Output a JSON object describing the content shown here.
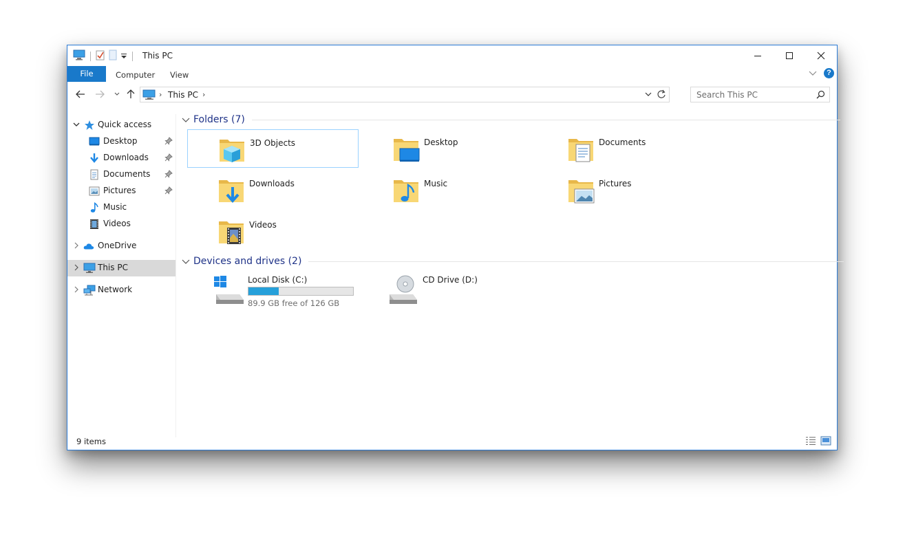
{
  "window": {
    "title": "This PC",
    "accent_color": "#1979ca"
  },
  "quick_access_toolbar": {
    "icons": [
      "computer-icon",
      "properties-icon",
      "new-folder-icon",
      "customize-dropdown-icon"
    ]
  },
  "window_controls": {
    "icons": [
      "minimize-icon",
      "maximize-icon",
      "close-icon"
    ]
  },
  "ribbon": {
    "tabs": [
      {
        "label": "File",
        "active": true
      },
      {
        "label": "Computer"
      },
      {
        "label": "View"
      }
    ],
    "help_label": "?"
  },
  "navigation": {
    "icons": [
      "back-arrow-icon",
      "forward-arrow-icon",
      "recent-locations-icon",
      "up-arrow-icon"
    ],
    "address": {
      "path": "This PC"
    },
    "search": {
      "placeholder": "Search This PC"
    }
  },
  "sidebar": {
    "items": [
      {
        "label": "Quick access",
        "icon": "star-icon",
        "level": 0,
        "expanded": true
      },
      {
        "label": "Desktop",
        "icon": "desktop-icon",
        "level": 1,
        "pinned": true
      },
      {
        "label": "Downloads",
        "icon": "download-arrow-icon",
        "level": 1,
        "pinned": true
      },
      {
        "label": "Documents",
        "icon": "document-icon",
        "level": 1,
        "pinned": true
      },
      {
        "label": "Pictures",
        "icon": "picture-icon",
        "level": 1,
        "pinned": true
      },
      {
        "label": "Music",
        "icon": "music-note-icon",
        "level": 1
      },
      {
        "label": "Videos",
        "icon": "film-icon",
        "level": 1
      },
      {
        "label": "OneDrive",
        "icon": "cloud-icon",
        "level": 0,
        "expanded": false
      },
      {
        "label": "This PC",
        "icon": "computer-icon",
        "level": 0,
        "expanded": false,
        "selected": true
      },
      {
        "label": "Network",
        "icon": "network-icon",
        "level": 0,
        "expanded": false
      }
    ]
  },
  "content": {
    "folders_group": {
      "title": "Folders (7)",
      "folders": [
        {
          "label": "3D Objects",
          "icon": "3d-objects-folder-icon",
          "selected": true
        },
        {
          "label": "Desktop",
          "icon": "desktop-folder-icon"
        },
        {
          "label": "Documents",
          "icon": "documents-folder-icon"
        },
        {
          "label": "Downloads",
          "icon": "downloads-folder-icon"
        },
        {
          "label": "Music",
          "icon": "music-folder-icon"
        },
        {
          "label": "Pictures",
          "icon": "pictures-folder-icon"
        },
        {
          "label": "Videos",
          "icon": "videos-folder-icon"
        }
      ]
    },
    "drives_group": {
      "title": "Devices and drives (2)",
      "drives": [
        {
          "label": "Local Disk (C:)",
          "icon": "windows-drive-icon",
          "free_text": "89.9 GB free of 126 GB",
          "used_fraction": 0.287
        },
        {
          "label": "CD Drive (D:)",
          "icon": "cd-drive-icon"
        }
      ]
    }
  },
  "status_bar": {
    "item_count": "9 items",
    "view_icons": [
      "details-view-icon",
      "large-icons-view-icon"
    ]
  }
}
